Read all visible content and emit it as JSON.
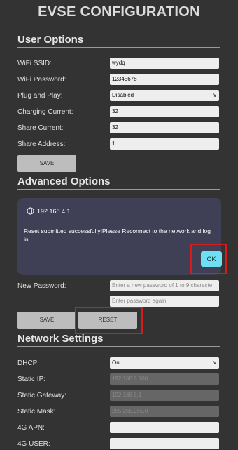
{
  "page_title": "EVSE CONFIGURATION",
  "user_options": {
    "title": "User Options",
    "fields": [
      {
        "label": "WiFi SSID:",
        "value": "wydq"
      },
      {
        "label": "WiFi Password:",
        "value": "12345678"
      },
      {
        "label": "Plug and Play:",
        "value": "Disabled"
      },
      {
        "label": "Charging Current:",
        "value": "32"
      },
      {
        "label": "Share Current:",
        "value": "32"
      },
      {
        "label": "Share Address:",
        "value": "1"
      }
    ],
    "save_label": "SAVE"
  },
  "advanced_options": {
    "title": "Advanced Options",
    "new_password_label": "New Password:",
    "new_password_placeholder": "Enter a new password of 1 to 9 characte",
    "confirm_placeholder": "Enter password again",
    "save_label": "SAVE",
    "reset_label": "RESET"
  },
  "dialog": {
    "host": "192.168.4.1",
    "message": "Reset submitted successfully!Please Reconnect to the network and log in.",
    "ok_label": "OK"
  },
  "network_settings": {
    "title": "Network Settings",
    "fields": [
      {
        "label": "DHCP",
        "value": "On"
      },
      {
        "label": "Static IP:",
        "value": "192.168.8.100"
      },
      {
        "label": "Static Gateway:",
        "value": "192.168.8.1"
      },
      {
        "label": "Static Mask:",
        "value": "255.255.255.0"
      },
      {
        "label": "4G APN:",
        "value": ""
      },
      {
        "label": "4G USER:",
        "value": ""
      }
    ]
  },
  "colors": {
    "background": "#333333",
    "dialog_bg": "#3f3f55",
    "ok_button": "#6ee0f3",
    "highlight": "#d91a1a"
  }
}
